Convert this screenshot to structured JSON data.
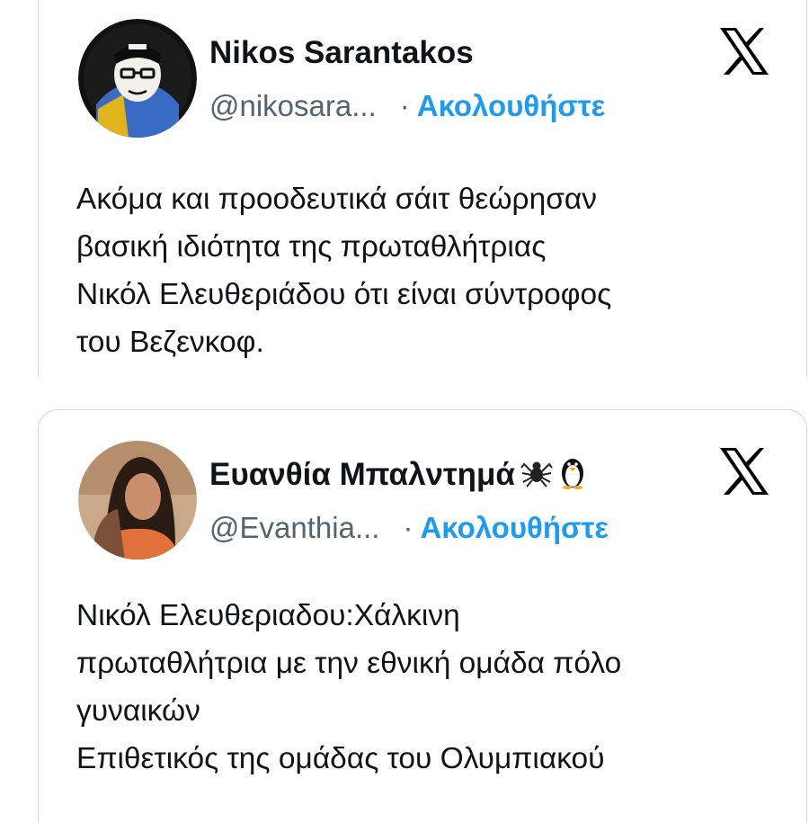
{
  "tweets": [
    {
      "author_name": "Nikos Sarantakos",
      "handle": "@nikosara...",
      "separator": "·",
      "follow_label": "Ακολουθήστε",
      "text": "Ακόμα και προοδευτικά σάιτ θεώρησαν\nβασική ιδιότητα της πρωταθλήτριας\nΝικόλ Ελευθεριάδου ότι είναι σύντροφος\nτου Βεζενκοφ."
    },
    {
      "author_name": "Ευανθία Μπαλντημά",
      "name_emojis": [
        "spider-icon",
        "penguin-icon"
      ],
      "handle": "@Evanthia...",
      "separator": "·",
      "follow_label": "Ακολουθήστε",
      "text": "Νικόλ Ελευθεριαδου:Χάλκινη\nπρωταθλήτρια με την εθνική ομάδα πόλο\nγυναικών\nΕπιθετικός της ομάδας του Ολυμπιακού"
    }
  ],
  "colors": {
    "text": "#0f1419",
    "secondary": "#536471",
    "accent": "#1d9bf0",
    "border": "#cfd9de"
  }
}
